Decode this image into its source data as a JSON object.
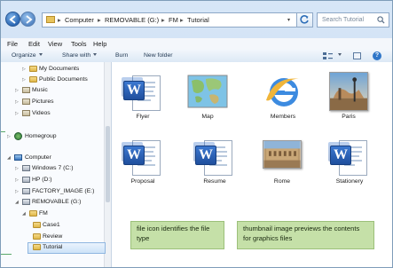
{
  "address": {
    "crumbs": [
      "Computer",
      "REMOVABLE (G:)",
      "FM",
      "Tutorial"
    ],
    "search_placeholder": "Search Tutorial"
  },
  "menu": [
    "File",
    "Edit",
    "View",
    "Tools",
    "Help"
  ],
  "toolbar": {
    "organize": "Organize",
    "share": "Share with",
    "burn": "Burn",
    "new_folder": "New folder"
  },
  "nav": [
    {
      "label": "My Documents",
      "icon": "folder"
    },
    {
      "label": "Public Documents",
      "icon": "folder"
    },
    {
      "label": "Music",
      "icon": "library"
    },
    {
      "label": "Pictures",
      "icon": "library"
    },
    {
      "label": "Videos",
      "icon": "library"
    },
    {
      "label": "Homegroup",
      "icon": "network"
    },
    {
      "label": "Computer",
      "icon": "computer"
    },
    {
      "label": "Windows 7 (C:)",
      "icon": "drive"
    },
    {
      "label": "HP (D:)",
      "icon": "drive"
    },
    {
      "label": "FACTORY_IMAGE (E:)",
      "icon": "drive"
    },
    {
      "label": "REMOVABLE (G:)",
      "icon": "drive"
    },
    {
      "label": "FM",
      "icon": "folder"
    },
    {
      "label": "Case1",
      "icon": "folder"
    },
    {
      "label": "Review",
      "icon": "folder"
    },
    {
      "label": "Tutorial",
      "icon": "folder",
      "selected": true
    }
  ],
  "files": [
    {
      "name": "Flyer",
      "kind": "word-doc-icon"
    },
    {
      "name": "Map",
      "kind": "map-thumbnail"
    },
    {
      "name": "Members",
      "kind": "ie-html-icon"
    },
    {
      "name": "Paris",
      "kind": "paris-photo-thumbnail"
    },
    {
      "name": "Proposal",
      "kind": "word-doc-icon"
    },
    {
      "name": "Resume",
      "kind": "word-doc-icon"
    },
    {
      "name": "Rome",
      "kind": "rome-photo-thumbnail"
    },
    {
      "name": "Stationery",
      "kind": "word-doc-icon"
    }
  ],
  "callouts": {
    "file_icon": "file icon identifies the file type",
    "thumbnail": "thumbnail image previews the contents for graphics files"
  }
}
